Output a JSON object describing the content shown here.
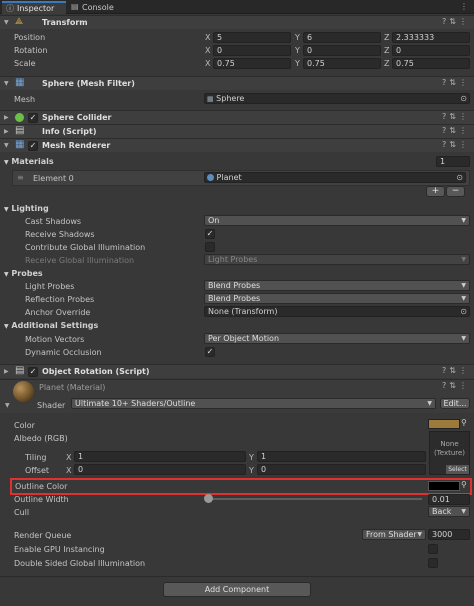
{
  "tabs": [
    {
      "label": "Inspector"
    },
    {
      "label": "Console"
    }
  ],
  "transform": {
    "title": "Transform",
    "position": {
      "label": "Position",
      "x": "5",
      "y": "6",
      "z": "2.333333"
    },
    "rotation": {
      "label": "Rotation",
      "x": "0",
      "y": "0",
      "z": "0"
    },
    "scale": {
      "label": "Scale",
      "x": "0.75",
      "y": "0.75",
      "z": "0.75"
    }
  },
  "axes": {
    "x": "X",
    "y": "Y",
    "z": "Z"
  },
  "mesh_filter": {
    "title": "Sphere (Mesh Filter)",
    "mesh_label": "Mesh",
    "mesh_value": "Sphere"
  },
  "sphere_collider": {
    "title": "Sphere Collider"
  },
  "info_script": {
    "title": "Info (Script)"
  },
  "mesh_renderer": {
    "title": "Mesh Renderer",
    "materials_label": "Materials",
    "materials_count": "1",
    "element0_label": "Element 0",
    "element0_value": "Planet",
    "lighting_label": "Lighting",
    "cast_shadows_label": "Cast Shadows",
    "cast_shadows_value": "On",
    "receive_shadows_label": "Receive Shadows",
    "contribute_gi_label": "Contribute Global Illumination",
    "receive_gi_label": "Receive Global Illumination",
    "receive_gi_value": "Light Probes",
    "probes_label": "Probes",
    "light_probes_label": "Light Probes",
    "light_probes_value": "Blend Probes",
    "reflection_probes_label": "Reflection Probes",
    "reflection_probes_value": "Blend Probes",
    "anchor_override_label": "Anchor Override",
    "anchor_override_value": "None (Transform)",
    "additional_label": "Additional Settings",
    "motion_vectors_label": "Motion Vectors",
    "motion_vectors_value": "Per Object Motion",
    "dynamic_occlusion_label": "Dynamic Occlusion"
  },
  "object_rotation": {
    "title": "Object Rotation (Script)"
  },
  "material": {
    "title": "Planet (Material)",
    "shader_label": "Shader",
    "shader_value": "Ultimate 10+ Shaders/Outline",
    "edit_label": "Edit...",
    "color_label": "Color",
    "albedo_label": "Albedo (RGB)",
    "texture_none": "None\n(Texture)",
    "select_label": "Select",
    "tiling_label": "Tiling",
    "tiling_x": "1",
    "tiling_y": "1",
    "offset_label": "Offset",
    "offset_x": "0",
    "offset_y": "0",
    "outline_color_label": "Outline Color",
    "outline_width_label": "Outline Width",
    "outline_width_value": "0.01",
    "outline_width_fraction": 0.0,
    "cull_label": "Cull",
    "cull_value": "Back",
    "render_queue_label": "Render Queue",
    "render_queue_mode": "From Shader",
    "render_queue_value": "3000",
    "gpu_instancing_label": "Enable GPU Instancing",
    "double_sided_gi_label": "Double Sided Global Illumination",
    "color_swatch": "#9c7a3c",
    "outline_color_swatch": "#000000"
  },
  "add_component_label": "Add Component",
  "highlight_color": "#e03030"
}
